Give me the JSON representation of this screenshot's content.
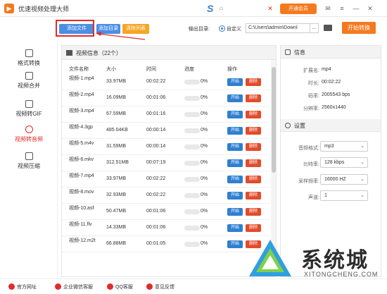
{
  "app": {
    "title": "优速视频处理大师",
    "vip_label": "开通会员",
    "brand_sub": "⌂"
  },
  "toolbar": {
    "add_file": "添加文件",
    "add_dir": "添加目录",
    "clear_list": "清除列表",
    "output_label": "输出目录:",
    "custom_label": "自定义",
    "output_path": "C:\\Users\\admin\\Downl",
    "more": "...",
    "start_convert": "开始转换"
  },
  "sidebar": {
    "items": [
      {
        "label": "格式转换",
        "active": false
      },
      {
        "label": "视频合并",
        "active": false
      },
      {
        "label": "视频转GIF",
        "active": false
      },
      {
        "label": "视频转音频",
        "active": true
      },
      {
        "label": "视频压缩",
        "active": false
      }
    ]
  },
  "list": {
    "title": "视频信息（22个）",
    "columns": [
      "文件名称",
      "大小",
      "时间",
      "进度",
      "操作"
    ],
    "start_label": "开始",
    "delete_label": "删除",
    "rows": [
      {
        "name": "视频-1.mp4",
        "size": "33.97MB",
        "time": "00:02:22",
        "progress": "0%"
      },
      {
        "name": "视频-2.mp4",
        "size": "16.09MB",
        "time": "00:01:06",
        "progress": "0%"
      },
      {
        "name": "视频-3.mp4",
        "size": "67.59MB",
        "time": "00:01:16",
        "progress": "0%"
      },
      {
        "name": "视频-4.3gp",
        "size": "485.04KB",
        "time": "00:00:14",
        "progress": "0%"
      },
      {
        "name": "视频-5.m4v",
        "size": "31.59MB",
        "time": "00:00:14",
        "progress": "0%"
      },
      {
        "name": "视频-6.mkv",
        "size": "312.51MB",
        "time": "00:07:19",
        "progress": "0%"
      },
      {
        "name": "视频-7.mp4",
        "size": "33.97MB",
        "time": "00:02:22",
        "progress": "0%"
      },
      {
        "name": "视频-8.mov",
        "size": "32.93MB",
        "time": "00:02:22",
        "progress": "0%"
      },
      {
        "name": "视频-10.asf",
        "size": "50.47MB",
        "time": "00:01:06",
        "progress": "0%"
      },
      {
        "name": "视频-11.flv",
        "size": "14.33MB",
        "time": "00:01:06",
        "progress": "0%"
      },
      {
        "name": "视频-12.m2t",
        "size": "66.88MB",
        "time": "00:01:05",
        "progress": "0%"
      }
    ]
  },
  "info": {
    "title": "信息",
    "fields": [
      {
        "label": "扩展名:",
        "value": "mp4"
      },
      {
        "label": "时长:",
        "value": "00:02:22"
      },
      {
        "label": "码率:",
        "value": "2005543 bps"
      },
      {
        "label": "分辨率:",
        "value": "2560x1440"
      }
    ]
  },
  "settings": {
    "title": "设置",
    "fields": [
      {
        "label": "音频格式:",
        "value": "mp3"
      },
      {
        "label": "比特率:",
        "value": "128 kbps"
      },
      {
        "label": "采样频率:",
        "value": "16000 HZ"
      },
      {
        "label": "声道:",
        "value": "1"
      }
    ]
  },
  "footer": {
    "items": [
      "官方网址",
      "企业微信客服",
      "QQ客服",
      "意见反馈"
    ]
  },
  "watermark": {
    "text": "系统城",
    "url": "XITONGCHENG.COM"
  },
  "colors": {
    "accent_blue": "#4a8ee5",
    "orange": "#f47a1f",
    "red": "#e02b2b",
    "delete_red": "#e24b2b"
  }
}
